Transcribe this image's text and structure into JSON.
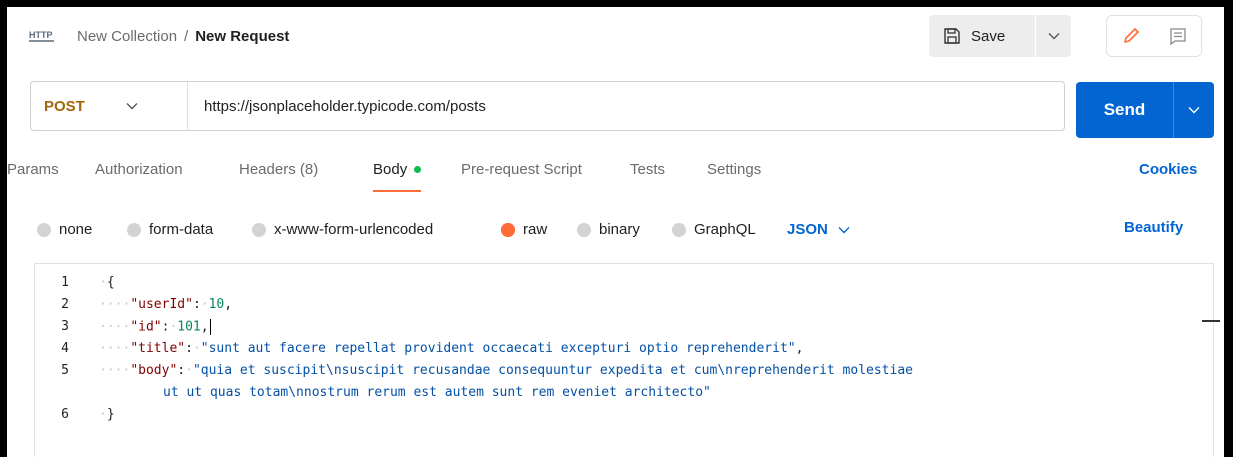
{
  "header": {
    "collection": "New Collection",
    "separator": "/",
    "request_name": "New Request",
    "save_label": "Save",
    "icons": [
      "http-icon",
      "save-icon",
      "chevron-down-icon",
      "pencil-icon",
      "comment-icon"
    ]
  },
  "request": {
    "method": "POST",
    "url": "https://jsonplaceholder.typicode.com/posts",
    "send_label": "Send",
    "method_color": "#a5660a",
    "send_color": "#0265d2"
  },
  "tabs": {
    "params": "Params",
    "authorization": "Authorization",
    "headers": "Headers (8)",
    "body": "Body",
    "prerequest": "Pre-request Script",
    "tests": "Tests",
    "settings": "Settings",
    "active": "Body",
    "cookies": "Cookies"
  },
  "body_types": {
    "none": "none",
    "form_data": "form-data",
    "urlencoded": "x-www-form-urlencoded",
    "raw": "raw",
    "binary": "binary",
    "graphql": "GraphQL",
    "selected": "raw",
    "format": "JSON",
    "beautify": "Beautify"
  },
  "editor": {
    "line_numbers": [
      "1",
      "2",
      "3",
      "4",
      "5",
      "6"
    ],
    "l1": "{",
    "l2_key": "\"userId\"",
    "l2_val": "10",
    "l3_key": "\"id\"",
    "l3_val": "101",
    "l4_key": "\"title\"",
    "l4_val": "\"sunt aut facere repellat provident occaecati excepturi optio reprehenderit\"",
    "l5_key": "\"body\"",
    "l5_val_a": "\"quia et suscipit\\nsuscipit recusandae consequuntur expedita et cum\\nreprehenderit molestiae",
    "l5_val_b": "ut ut quas totam\\nnostrum rerum est autem sunt rem eveniet architecto\"",
    "l6": "}"
  }
}
